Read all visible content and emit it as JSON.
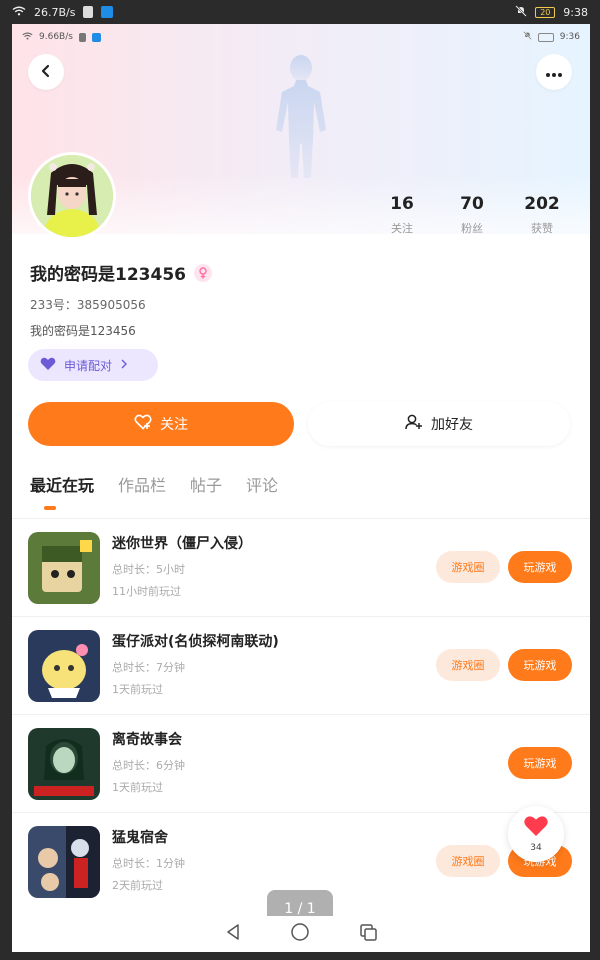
{
  "outer_status": {
    "speed": "26.7B/s",
    "battery": "20",
    "time": "9:38"
  },
  "inner_status": {
    "speed": "9.66B/s",
    "time": "9:36"
  },
  "profile": {
    "username": "我的密码是123456",
    "id_line": "233号：385905056",
    "bio": "我的密码是123456",
    "match_label": "申请配对",
    "stats": [
      {
        "num": "16",
        "label": "关注"
      },
      {
        "num": "70",
        "label": "粉丝"
      },
      {
        "num": "202",
        "label": "获赞"
      }
    ]
  },
  "actions": {
    "follow_label": "关注",
    "add_friend_label": "加好友"
  },
  "tabs": [
    "最近在玩",
    "作品栏",
    "帖子",
    "评论"
  ],
  "games": [
    {
      "title": "迷你世界（僵尸入侵）",
      "duration": "总时长：5小时",
      "last": "11小时前玩过",
      "circle": "游戏圈",
      "play": "玩游戏",
      "thumb_bg": "#5c7a3a",
      "thumb_accent": "#ffd84a"
    },
    {
      "title": "蛋仔派对(名侦探柯南联动)",
      "duration": "总时长：7分钟",
      "last": "1天前玩过",
      "circle": "游戏圈",
      "play": "玩游戏",
      "thumb_bg": "#2a3a5c",
      "thumb_accent": "#f7e27a"
    },
    {
      "title": "离奇故事会",
      "duration": "总时长：6分钟",
      "last": "1天前玩过",
      "circle": "",
      "play": "玩游戏",
      "thumb_bg": "#1f3a2c",
      "thumb_accent": "#c22"
    },
    {
      "title": "猛鬼宿舍",
      "duration": "总时长：1分钟",
      "last": "2天前玩过",
      "circle": "游戏圈",
      "play": "玩游戏",
      "thumb_bg": "#3a4a6a",
      "thumb_accent": "#e8c9a8"
    }
  ],
  "like_fab": {
    "count": "34"
  },
  "page_indicator": "1 / 1",
  "colors": {
    "accent": "#ff7a1a",
    "match": "#6b5bd6"
  }
}
